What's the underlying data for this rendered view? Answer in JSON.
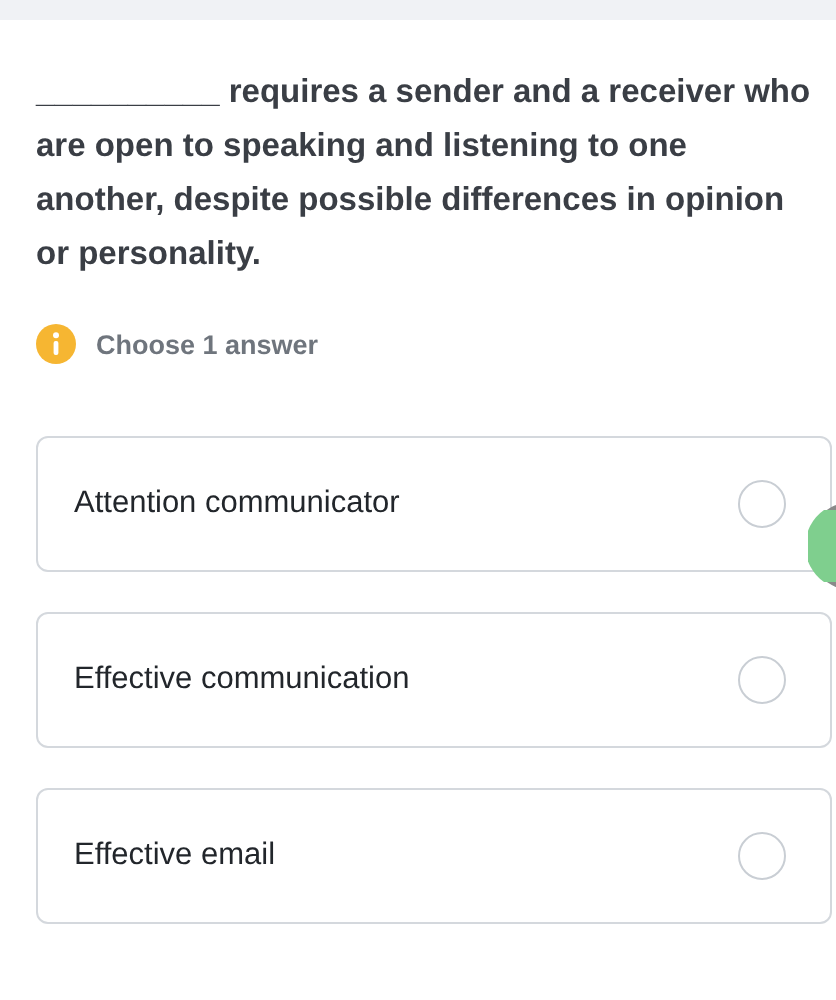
{
  "question": {
    "text": "__________ requires a sender and a receiver who are open to speaking and listening to one another, despite possible differences in opinion or personality."
  },
  "instruction": "Choose 1 answer",
  "options": [
    {
      "label": "Attention communicator",
      "selected": false
    },
    {
      "label": "Effective communication",
      "selected": false
    },
    {
      "label": "Effective email",
      "selected": false
    }
  ]
}
